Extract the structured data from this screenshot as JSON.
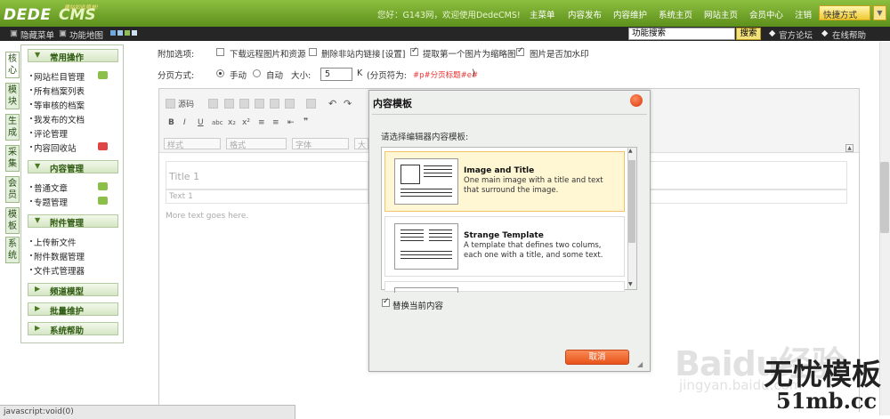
{
  "app": {
    "logo_text": "DEDECMS",
    "slogan": "建站如此简单!"
  },
  "topnav": {
    "greeting": "您好：G143网，欢迎使用DedeCMS!",
    "links": [
      "主菜单",
      "内容发布",
      "内容维护",
      "系统主页",
      "网站主页",
      "会员中心",
      "注销"
    ],
    "quick": "快捷方式"
  },
  "bar2": {
    "hide_menu": "隐藏菜单",
    "function_map": "功能地图",
    "search_value": "功能搜索",
    "search_btn": "搜索",
    "forum": "官方论坛",
    "help": "在线帮助"
  },
  "vtabs": [
    "核心",
    "模块",
    "生成",
    "采集",
    "会员",
    "模板",
    "系统"
  ],
  "menu": {
    "section1": "常用操作",
    "items1": [
      "网站栏目管理",
      "所有档案列表",
      "等审核的档案",
      "我发布的文档",
      "评论管理",
      "内容回收站"
    ],
    "section2": "内容管理",
    "items2": [
      "普通文章",
      "专题管理"
    ],
    "section3": "附件管理",
    "items3": [
      "上传新文件",
      "附件数据管理",
      "文件式管理器"
    ],
    "section4": "频道模型",
    "section5": "批量维护",
    "section6": "系统帮助"
  },
  "form": {
    "extra_label": "附加选项:",
    "opt1": "下载远程图片和资源",
    "opt2": "删除非站内链接",
    "opt2_link": "[设置]",
    "opt3": "提取第一个图片为缩略图",
    "opt4": "图片是否加水印",
    "page_label": "分页方式:",
    "manual": "手动",
    "auto": "自动",
    "size_label": "大小:",
    "size_value": "5",
    "size_unit": "K",
    "page_sep_label": "(分页符为:",
    "page_sep_value": "#p#分页标题#e#",
    "page_sep_close": ")"
  },
  "editor": {
    "source_btn": "源码",
    "style_sel": "样式",
    "format_sel": "格式",
    "font_sel": "字体",
    "size_sel": "大",
    "title1": "Title 1",
    "text1": "Text 1",
    "more_text": "More text goes here."
  },
  "dialog": {
    "title": "内容模板",
    "prompt": "请选择编辑器内容模板:",
    "templates": [
      {
        "name": "Image and Title",
        "desc": "One main image with a title and text that surround the image."
      },
      {
        "name": "Strange Template",
        "desc": "A template that defines two colums, each one with a title, and some text."
      }
    ],
    "replace_label": "替换当前内容",
    "replace_checked": true,
    "cancel": "取消"
  },
  "statusbar": "javascript:void(0)",
  "watermark": {
    "baidu": "Baidu经验",
    "jingyan": "jingyan.baidu.com",
    "cn": "无忧模板",
    "url": "51mb.cc"
  },
  "colors": {
    "topbar": "#6fa32a",
    "accent_orange": "#e8531a",
    "selected_template": "#fff6d3"
  }
}
